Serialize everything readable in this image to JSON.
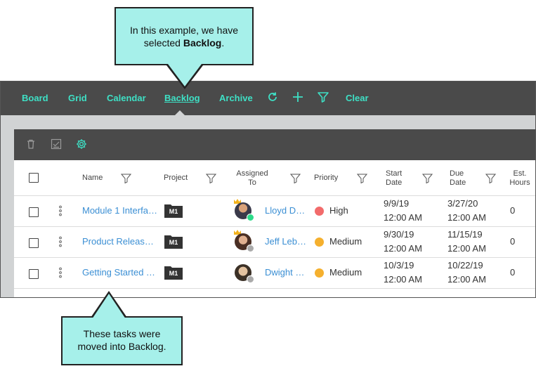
{
  "callouts": {
    "top_line1": "In this example, we have",
    "top_line2_prefix": "selected ",
    "top_line2_bold": "Backlog",
    "top_line2_suffix": ".",
    "bottom_line1": "These tasks were",
    "bottom_line2": "moved into Backlog."
  },
  "nav": {
    "board": "Board",
    "grid": "Grid",
    "calendar": "Calendar",
    "backlog": "Backlog",
    "archive": "Archive",
    "clear": "Clear",
    "active": "Backlog",
    "accent_color": "#3ee0c5"
  },
  "toolbar": {
    "icons": [
      "trash-icon",
      "checklist-icon",
      "gear-icon"
    ]
  },
  "grid": {
    "headers": {
      "name": "Name",
      "project": "Project",
      "assigned_to_1": "Assigned",
      "assigned_to_2": "To",
      "priority": "Priority",
      "start_date_1": "Start",
      "start_date_2": "Date",
      "due_date_1": "Due",
      "due_date_2": "Date",
      "est_hours_1": "Est.",
      "est_hours_2": "Hours"
    },
    "rows": [
      {
        "name": "Module 1 Interfa…",
        "project": "M1",
        "assignee": "Lloyd Do…",
        "priority": "High",
        "priority_color": "#f26b6b",
        "start_date": "9/9/19",
        "start_time": "12:00 AM",
        "due_date": "3/27/20",
        "due_time": "12:00 AM",
        "est_hours": "0",
        "status_color": "#2ddb8a"
      },
      {
        "name": "Product Release …",
        "project": "M1",
        "assignee": "Jeff Leb…",
        "priority": "Medium",
        "priority_color": "#f5b02e",
        "start_date": "9/30/19",
        "start_time": "12:00 AM",
        "due_date": "11/15/19",
        "due_time": "12:00 AM",
        "est_hours": "0",
        "status_color": "#aaaaaa"
      },
      {
        "name": "Getting Started T…",
        "project": "M1",
        "assignee": "Dwight S…",
        "priority": "Medium",
        "priority_color": "#f5b02e",
        "start_date": "10/3/19",
        "start_time": "12:00 AM",
        "due_date": "10/22/19",
        "due_time": "12:00 AM",
        "est_hours": "0",
        "status_color": "#aaaaaa"
      }
    ]
  }
}
